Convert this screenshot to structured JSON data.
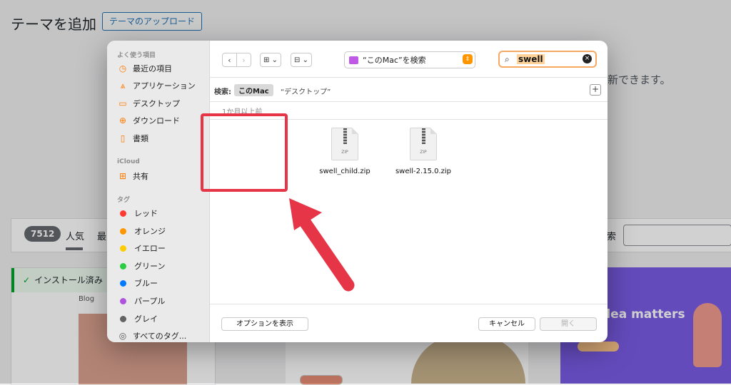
{
  "background": {
    "page_title": "テーマを追加",
    "upload_button": "テーマのアップロード",
    "notice_text": "更新できます。",
    "theme_count": "7512",
    "tab_popular": "人気",
    "tab_latest": "最",
    "search_label": "索",
    "installed_label": "インストール済み",
    "card1_caption": "Blog",
    "card3_headline": "dea matters"
  },
  "sidebar": {
    "favorites_title": "よく使う項目",
    "favorites": [
      {
        "label": "最近の項目",
        "icon": "clock-icon"
      },
      {
        "label": "アプリケーション",
        "icon": "applications-icon"
      },
      {
        "label": "デスクトップ",
        "icon": "desktop-icon"
      },
      {
        "label": "ダウンロード",
        "icon": "download-icon"
      },
      {
        "label": "書類",
        "icon": "document-icon"
      }
    ],
    "icloud_title": "iCloud",
    "icloud_items": [
      {
        "label": "共有",
        "icon": "shared-folder-icon"
      }
    ],
    "tags_title": "タグ",
    "tags": [
      {
        "label": "レッド",
        "color": "#ff3b30"
      },
      {
        "label": "オレンジ",
        "color": "#ff9500"
      },
      {
        "label": "イエロー",
        "color": "#ffcc00"
      },
      {
        "label": "グリーン",
        "color": "#28cd41"
      },
      {
        "label": "ブルー",
        "color": "#007aff"
      },
      {
        "label": "パープル",
        "color": "#af52de"
      },
      {
        "label": "グレイ",
        "color": "#8e8e93"
      }
    ],
    "all_tags": "すべてのタグ..."
  },
  "toolbar": {
    "back": "‹",
    "forward": "›",
    "location": "“このMac”を検索",
    "search_value": "swell"
  },
  "scope": {
    "label": "検索:",
    "active": "このMac",
    "other": "“デスクトップ”"
  },
  "group_header": "1か月以上前",
  "files": [
    {
      "name": "swell_child.zip",
      "badge": "ZIP"
    },
    {
      "name": "swell-2.15.0.zip",
      "badge": "ZIP"
    }
  ],
  "buttons": {
    "options": "オプションを表示",
    "cancel": "キャンセル",
    "open": "開く"
  },
  "annotation": {
    "color": "#e53546"
  }
}
